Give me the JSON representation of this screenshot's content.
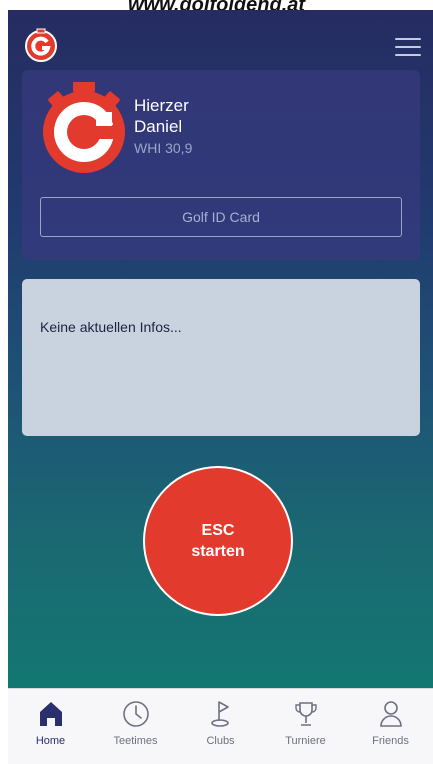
{
  "top_caption": "www.golfolgeng.at",
  "header": {
    "logo_icon": "golf-g-logo",
    "menu_icon": "hamburger-menu-icon"
  },
  "profile": {
    "last_name": "Hierzer",
    "first_name": "Daniel",
    "hcp": "WHI 30,9",
    "idcard_label": "Golf ID Card"
  },
  "info": {
    "text": "Keine aktuellen Infos..."
  },
  "esc_button": {
    "line1": "ESC",
    "line2": "starten"
  },
  "tabs": [
    {
      "label": "Home",
      "icon": "home-icon",
      "active": true
    },
    {
      "label": "Teetimes",
      "icon": "clock-icon",
      "active": false
    },
    {
      "label": "Clubs",
      "icon": "golf-flag-icon",
      "active": false
    },
    {
      "label": "Turniere",
      "icon": "trophy-icon",
      "active": false
    },
    {
      "label": "Friends",
      "icon": "person-icon",
      "active": false
    }
  ],
  "colors": {
    "brand_red": "#e33a2e",
    "active_tab": "#2a2f6d"
  }
}
